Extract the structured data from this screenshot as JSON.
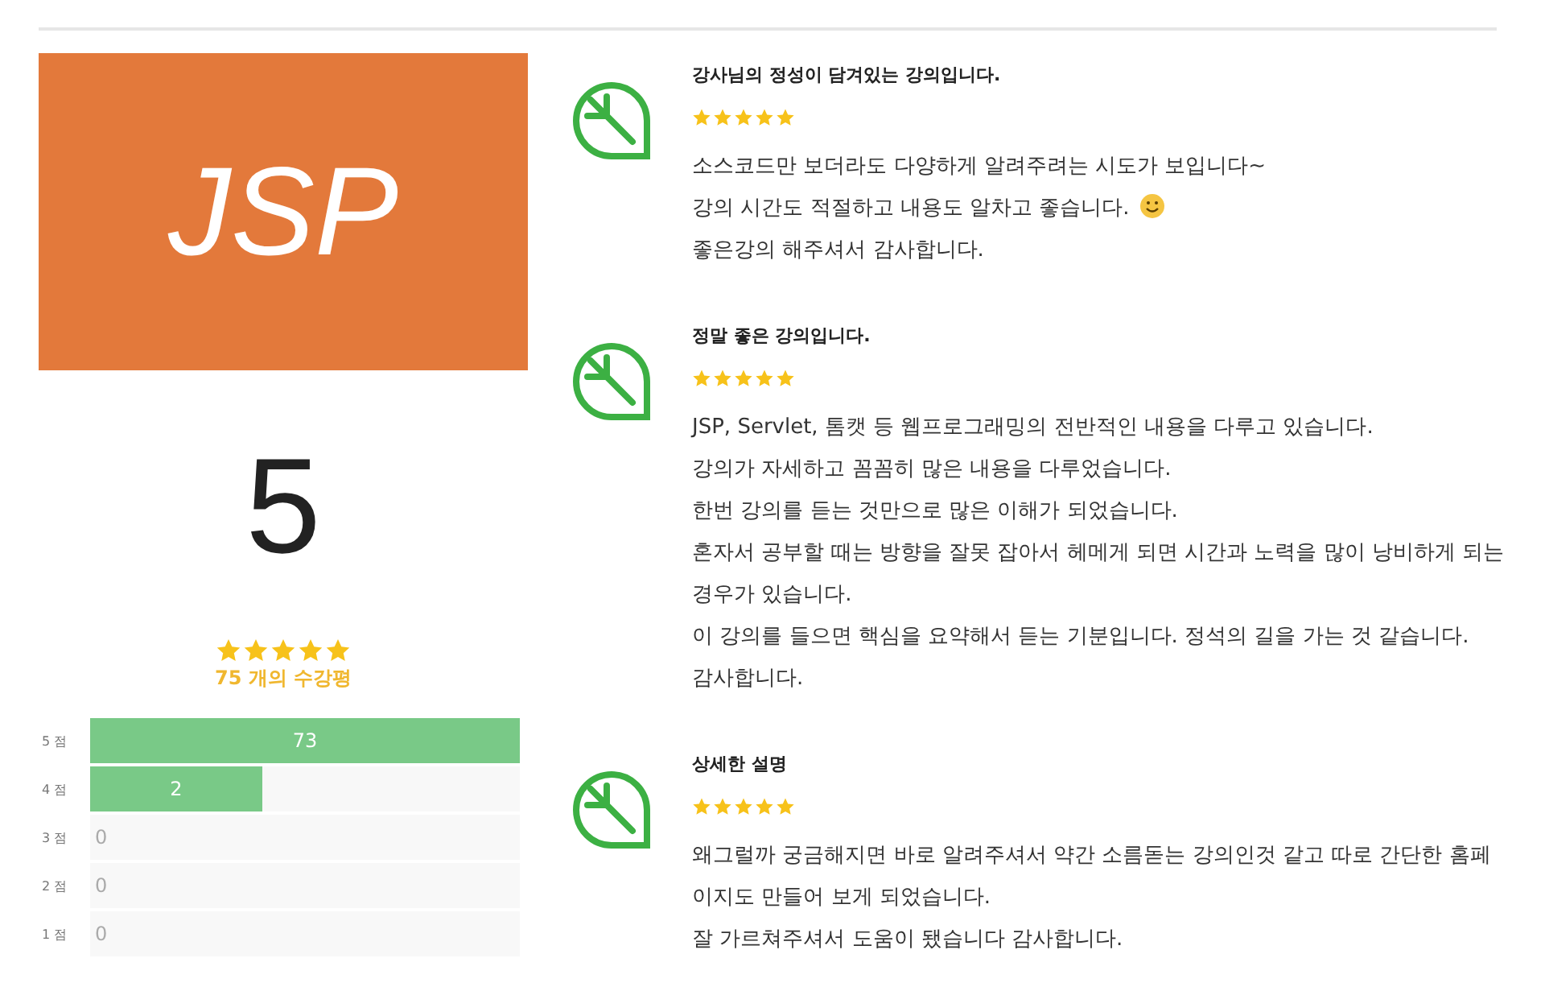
{
  "course": {
    "thumbnail_text": "JSP"
  },
  "summary": {
    "average": "5",
    "stars": 5,
    "count": "75 개의 수강평"
  },
  "distribution": [
    {
      "label": "5 점",
      "count": "73",
      "level": 1
    },
    {
      "label": "4 점",
      "count": "2",
      "level": 0.4
    },
    {
      "label": "3 점",
      "count": "0",
      "level": 0
    },
    {
      "label": "2 점",
      "count": "0",
      "level": 0
    },
    {
      "label": "1 점",
      "count": "0",
      "level": 0
    }
  ],
  "reviews": [
    {
      "title": "강사님의 정성이 담겨있는 강의입니다.",
      "stars": 5,
      "lines": [
        {
          "text": "소스코드만 보더라도 다양하게 알려주려는 시도가 보입니다~",
          "smiley": false
        },
        {
          "text": "강의 시간도 적절하고 내용도 알차고 좋습니다.",
          "smiley": true
        },
        {
          "text": "좋은강의 해주셔서 감사합니다.",
          "smiley": false
        }
      ]
    },
    {
      "title": "정말 좋은 강의입니다.",
      "stars": 5,
      "lines": [
        {
          "text": "JSP, Servlet, 톰캣 등 웹프로그래밍의 전반적인 내용을 다루고 있습니다.",
          "smiley": false
        },
        {
          "text": "강의가 자세하고 꼼꼼히 많은 내용을 다루었습니다.",
          "smiley": false
        },
        {
          "text": "한번 강의를 듣는 것만으로 많은 이해가 되었습니다.",
          "smiley": false
        },
        {
          "text": "혼자서 공부할 때는 방향을 잘못 잡아서 헤메게 되면 시간과 노력을 많이 낭비하게 되는 경우가 있습니다.",
          "smiley": false
        },
        {
          "text": "이 강의를 들으면 핵심을 요약해서 듣는 기분입니다. 정석의 길을 가는 것 같습니다.",
          "smiley": false
        },
        {
          "text": "감사합니다.",
          "smiley": false
        }
      ]
    },
    {
      "title": "상세한 설명",
      "stars": 5,
      "lines": [
        {
          "text": "왜그럴까 궁금해지면 바로 알려주셔서 약간 소름돋는 강의인것 같고 따로 간단한 홈페이지도 만들어 보게 되었습니다.",
          "smiley": false
        },
        {
          "text": "잘 가르쳐주셔서 도움이 됐습니다 감사합니다.",
          "smiley": false
        }
      ]
    }
  ]
}
